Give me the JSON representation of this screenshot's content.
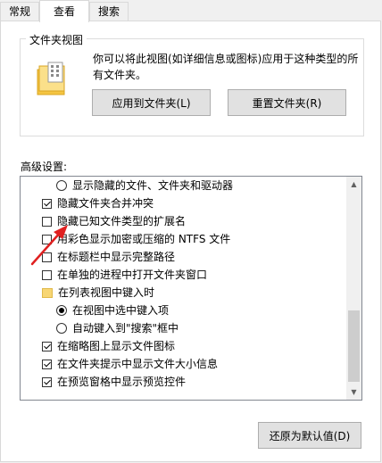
{
  "tabs": [
    {
      "label": "常规",
      "active": false
    },
    {
      "label": "查看",
      "active": true
    },
    {
      "label": "搜索",
      "active": false
    }
  ],
  "folder_views": {
    "title": "文件夹视图",
    "description": "你可以将此视图(如详细信息或图标)应用于这种类型的所有文件夹。",
    "apply_button": "应用到文件夹(L)",
    "reset_button": "重置文件夹(R)"
  },
  "advanced": {
    "label": "高级设置:",
    "items": [
      {
        "type": "radio",
        "checked": false,
        "label": "显示隐藏的文件、文件夹和驱动器"
      },
      {
        "type": "checkbox",
        "checked": true,
        "label": "隐藏文件夹合并冲突"
      },
      {
        "type": "checkbox",
        "checked": false,
        "label": "隐藏已知文件类型的扩展名"
      },
      {
        "type": "checkbox",
        "checked": false,
        "label": "用彩色显示加密或压缩的 NTFS 文件"
      },
      {
        "type": "checkbox",
        "checked": false,
        "label": "在标题栏中显示完整路径"
      },
      {
        "type": "checkbox",
        "checked": false,
        "label": "在单独的进程中打开文件夹窗口"
      },
      {
        "type": "folder",
        "label": "在列表视图中键入时"
      },
      {
        "type": "radio",
        "checked": true,
        "label": "在视图中选中键入项"
      },
      {
        "type": "radio",
        "checked": false,
        "label": "自动键入到\"搜索\"框中"
      },
      {
        "type": "checkbox",
        "checked": true,
        "label": "在缩略图上显示文件图标"
      },
      {
        "type": "checkbox",
        "checked": true,
        "label": "在文件夹提示中显示文件大小信息"
      },
      {
        "type": "checkbox",
        "checked": true,
        "label": "在预览窗格中显示预览控件"
      }
    ]
  },
  "restore_button": "还原为默认值(D)",
  "colors": {
    "annotation_arrow": "#e02020"
  },
  "icons": {
    "folder": "folder-icon",
    "scroll_up": "chevron-up-icon",
    "scroll_down": "chevron-down-icon"
  }
}
